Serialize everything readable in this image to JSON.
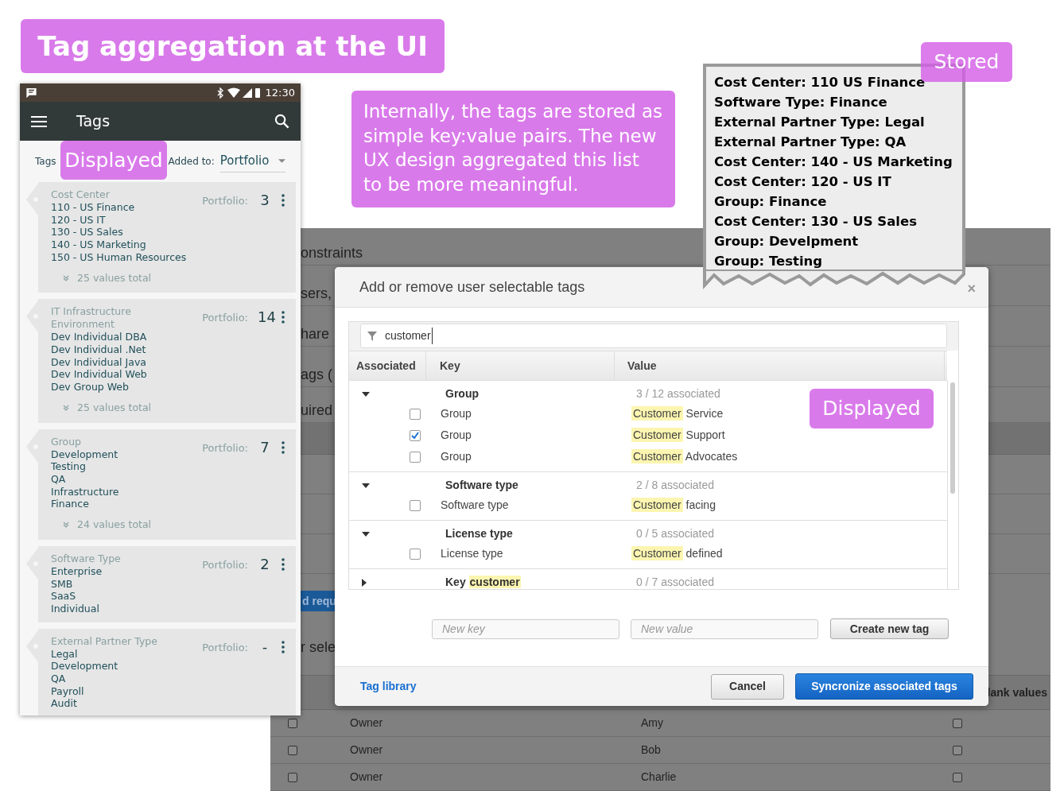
{
  "title_label": "Tag aggregation at the UI",
  "phone": {
    "status_time": "12:30",
    "app_bar_title": "Tags",
    "filter": {
      "total_label": "Tags",
      "added_to_label": "Added to:",
      "value": "Portfolio"
    },
    "callout": "Displayed",
    "cards": [
      {
        "key": "Cost Center",
        "values": [
          "110 - US Finance",
          "120 - US IT",
          "130 - US Sales",
          "140 - US Marketing",
          "150 - US Human Resources"
        ],
        "portfolio_label": "Portfolio:",
        "count": "3",
        "total": "25 values total"
      },
      {
        "key": "IT Infrastructure Environment",
        "values": [
          "Dev Individual DBA",
          "Dev Individual .Net",
          "Dev Individual Java",
          "Dev Individual Web",
          "Dev Group Web"
        ],
        "portfolio_label": "Portfolio:",
        "count": "14",
        "total": "25 values total"
      },
      {
        "key": "Group",
        "values": [
          "Development",
          "Testing",
          "QA",
          "Infrastructure",
          "Finance"
        ],
        "portfolio_label": "Portfolio:",
        "count": "7",
        "total": "24 values total"
      },
      {
        "key": "Software Type",
        "values": [
          "Enterprise",
          "SMB",
          "SaaS",
          "Individual"
        ],
        "portfolio_label": "Portfolio:",
        "count": "2"
      },
      {
        "key": "External Partner Type",
        "values": [
          "Legal",
          "Development",
          "QA",
          "Payroll",
          "Audit"
        ],
        "portfolio_label": "Portfolio:",
        "count": "-"
      }
    ]
  },
  "internal_note": "Internally, the tags are stored as simple key:value pairs. The new UX design aggregated this list to be more meaningful.",
  "stored_note": {
    "label": "Stored",
    "lines": [
      "Cost Center: 110 US Finance",
      "Software Type: Finance",
      "External Partner Type: Legal",
      "External Partner Type: QA",
      "Cost Center: 140 - US Marketing",
      "Cost Center: 120 - US IT",
      "Group: Finance",
      "Cost Center: 130 - US Sales",
      "Group: Develpment",
      "Group: Testing"
    ]
  },
  "background_page": {
    "fragments": [
      "onstraints",
      "sers,",
      "hare",
      "ags (",
      "uired"
    ],
    "button": "d requ",
    "section_fragment": "r sele",
    "header_cell": "lank values",
    "rows": [
      {
        "key": "Owner",
        "value": "Amy",
        "selected": false,
        "blank_allowed": false
      },
      {
        "key": "Owner",
        "value": "Bob",
        "selected": false,
        "blank_allowed": false
      },
      {
        "key": "Owner",
        "value": "Charlie",
        "selected": false,
        "blank_allowed": false
      }
    ]
  },
  "modal": {
    "title": "Add or remove user selectable tags",
    "close": "×",
    "search_value": "customer",
    "columns": [
      "Associated",
      "Key",
      "Value"
    ],
    "callout": "Displayed",
    "groups": [
      {
        "key": "Group",
        "expanded": true,
        "summary": "3 / 12 associated",
        "items": [
          {
            "key": "Group",
            "checked": false,
            "match": "Customer",
            "rest": "Service"
          },
          {
            "key": "Group",
            "checked": true,
            "match": "Customer",
            "rest": "Support"
          },
          {
            "key": "Group",
            "checked": false,
            "match": "Customer",
            "rest": "Advocates"
          }
        ]
      },
      {
        "key": "Software type",
        "expanded": true,
        "summary": "2 / 8 associated",
        "items": [
          {
            "key": "Software type",
            "checked": false,
            "match": "Customer",
            "rest": "facing"
          }
        ]
      },
      {
        "key": "License type",
        "expanded": true,
        "summary": "0 / 5 associated",
        "items": [
          {
            "key": "License type",
            "checked": false,
            "match": "Customer",
            "rest": "defined"
          }
        ]
      },
      {
        "key": "Key",
        "key_match": "customer",
        "expanded": false,
        "summary": "0 / 7 associated"
      }
    ],
    "new_key_placeholder": "New key",
    "new_value_placeholder": "New value",
    "create_button": "Create new tag",
    "tag_library_link": "Tag library",
    "cancel_button": "Cancel",
    "sync_button": "Syncronize associated tags"
  }
}
